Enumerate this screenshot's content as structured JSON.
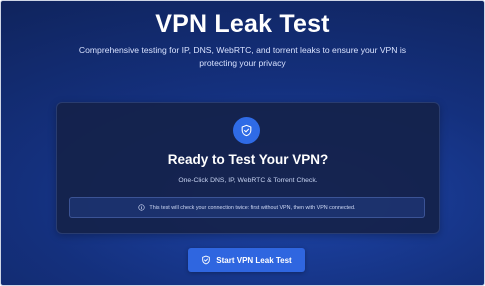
{
  "header": {
    "title": "VPN Leak Test",
    "subtitle": "Comprehensive testing for IP, DNS, WebRTC, and torrent leaks to ensure your VPN is protecting your privacy"
  },
  "card": {
    "icon": "shield-check-icon",
    "title": "Ready to Test Your VPN?",
    "subtitle": "One-Click DNS, IP, WebRTC & Torrent Check.",
    "notice": {
      "icon": "info-icon",
      "text": "This test will check your connection twice: first without VPN, then with VPN connected."
    }
  },
  "actions": {
    "start_icon": "shield-icon",
    "start_label": "Start VPN Leak Test"
  },
  "colors": {
    "background": "#14307d",
    "card": "#15224a",
    "accent": "#2f66e0",
    "text": "#ffffff"
  }
}
